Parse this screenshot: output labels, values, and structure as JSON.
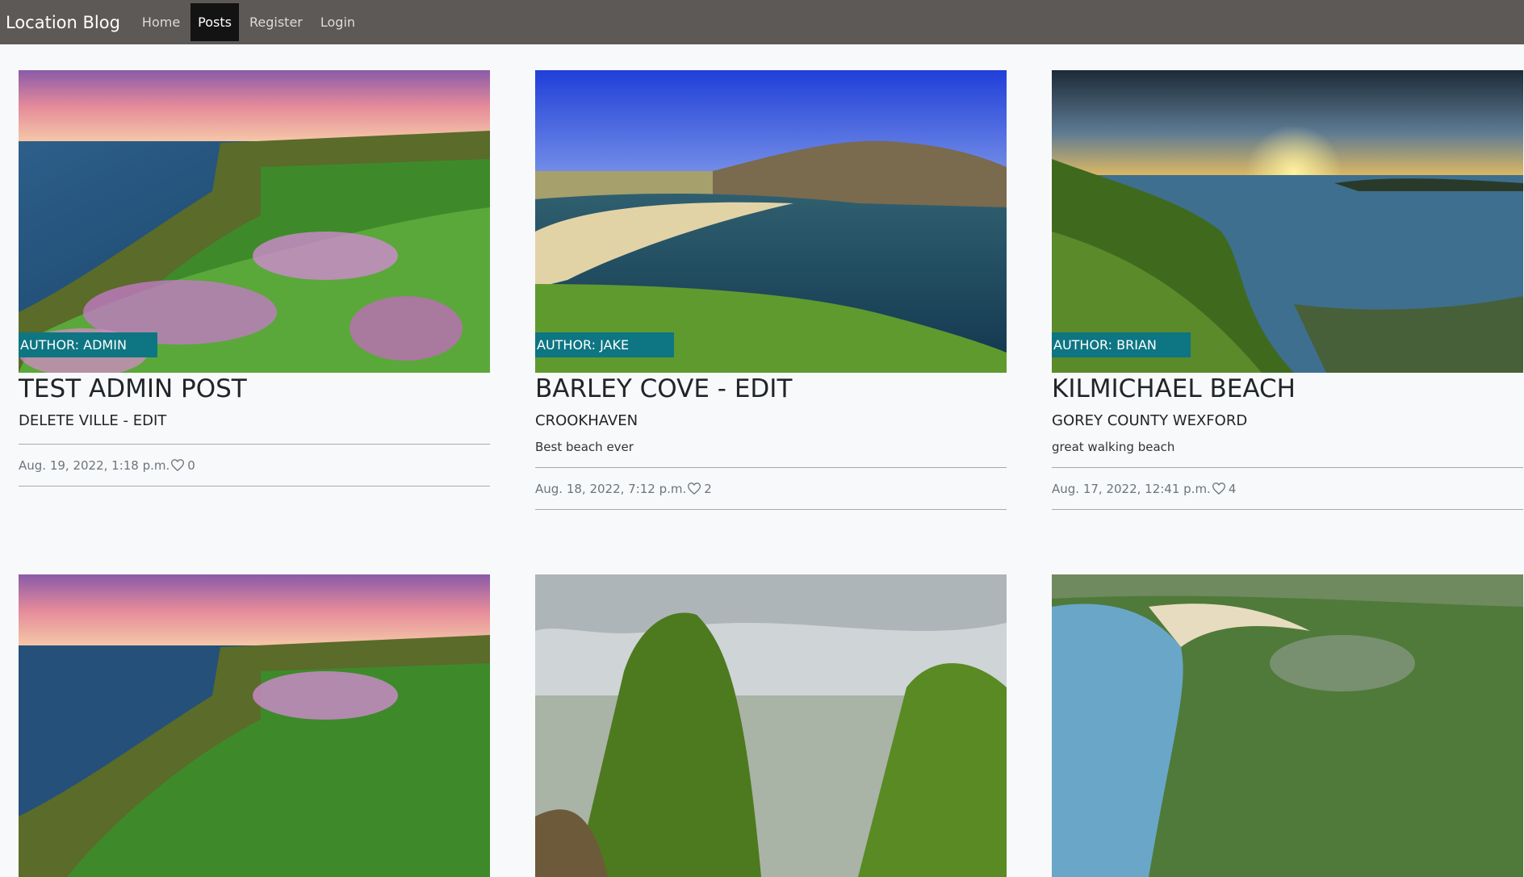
{
  "nav": {
    "brand": "Location Blog",
    "links": [
      "Home",
      "Posts",
      "Register",
      "Login"
    ],
    "active": "Posts"
  },
  "posts": [
    {
      "author": "AUTHOR: ADMIN",
      "title": "TEST ADMIN POST",
      "location": "DELETE VILLE - EDIT",
      "description": "",
      "date": "Aug. 19, 2022, 1:18 p.m.",
      "likes": "0",
      "image": "cliff-flowers-sunset"
    },
    {
      "author": "AUTHOR: JAKE",
      "title": "BARLEY COVE - EDIT",
      "location": "CROOKHAVEN",
      "description": "Best beach ever",
      "date": "Aug. 18, 2022, 7:12 p.m.",
      "likes": "2",
      "image": "cove-beach-blue-sky"
    },
    {
      "author": "AUTHOR: BRIAN",
      "title": "KILMICHAEL BEACH",
      "location": "GOREY COUNTY WEXFORD",
      "description": "great walking beach",
      "date": "Aug. 17, 2022, 12:41 p.m.",
      "likes": "4",
      "image": "coast-sunset-grass"
    },
    {
      "image": "cliff-flowers-sunset"
    },
    {
      "image": "green-rocks-sea"
    },
    {
      "image": "aerial-coastline"
    }
  ],
  "colors": {
    "navbar": "#5c5957",
    "active_nav": "#131313",
    "author_badge": "#0e7582",
    "page_bg": "#f8f9fa"
  },
  "icons": [
    "heart-icon"
  ]
}
